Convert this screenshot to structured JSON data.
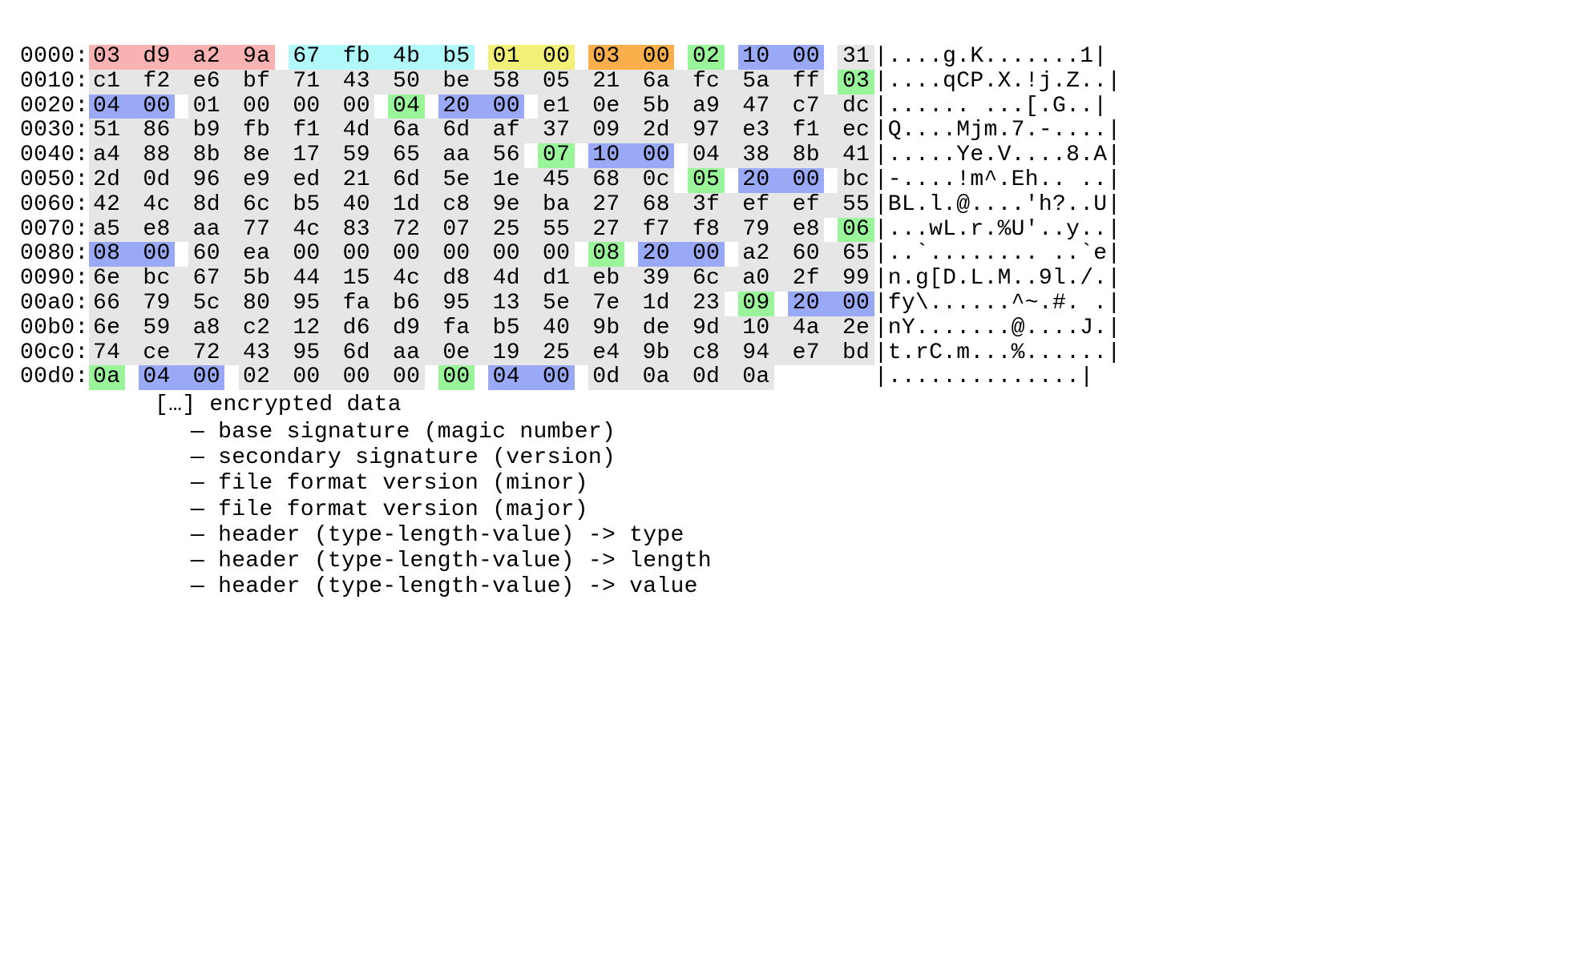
{
  "colors": {
    "pink": "#fab1b1",
    "cyan": "#b1f8fa",
    "yellow": "#f2f077",
    "orange": "#faaf4a",
    "green": "#9af59a",
    "blue": "#9aa9f5",
    "grey": "#e6e6e6"
  },
  "note": "[…] encrypted data",
  "legend": [
    {
      "color": "pink",
      "label": "— base signature (magic number)"
    },
    {
      "color": "cyan",
      "label": "— secondary signature (version)"
    },
    {
      "color": "yellow",
      "label": "— file format version (minor)"
    },
    {
      "color": "orange",
      "label": "— file format version (major)"
    },
    {
      "color": "green",
      "label": "— header (type-length-value) -> type"
    },
    {
      "color": "blue",
      "label": "— header (type-length-value) -> length"
    },
    {
      "color": "grey",
      "label": "— header (type-length-value) -> value"
    }
  ],
  "rows": [
    {
      "offset": "0000:",
      "bytes": [
        {
          "v": "03",
          "c": "pink"
        },
        {
          "v": "d9",
          "c": "pink"
        },
        {
          "v": "a2",
          "c": "pink"
        },
        {
          "v": "9a",
          "c": "pink"
        },
        {
          "v": "67",
          "c": "cyan"
        },
        {
          "v": "fb",
          "c": "cyan"
        },
        {
          "v": "4b",
          "c": "cyan"
        },
        {
          "v": "b5",
          "c": "cyan"
        },
        {
          "v": "01",
          "c": "yellow"
        },
        {
          "v": "00",
          "c": "yellow"
        },
        {
          "v": "03",
          "c": "orange"
        },
        {
          "v": "00",
          "c": "orange"
        },
        {
          "v": "02",
          "c": "green"
        },
        {
          "v": "10",
          "c": "blue"
        },
        {
          "v": "00",
          "c": "blue"
        },
        {
          "v": "31",
          "c": "grey"
        }
      ],
      "ascii": "|....g.K.......1|"
    },
    {
      "offset": "0010:",
      "bytes": [
        {
          "v": "c1",
          "c": "grey"
        },
        {
          "v": "f2",
          "c": "grey"
        },
        {
          "v": "e6",
          "c": "grey"
        },
        {
          "v": "bf",
          "c": "grey"
        },
        {
          "v": "71",
          "c": "grey"
        },
        {
          "v": "43",
          "c": "grey"
        },
        {
          "v": "50",
          "c": "grey"
        },
        {
          "v": "be",
          "c": "grey"
        },
        {
          "v": "58",
          "c": "grey"
        },
        {
          "v": "05",
          "c": "grey"
        },
        {
          "v": "21",
          "c": "grey"
        },
        {
          "v": "6a",
          "c": "grey"
        },
        {
          "v": "fc",
          "c": "grey"
        },
        {
          "v": "5a",
          "c": "grey"
        },
        {
          "v": "ff",
          "c": "grey"
        },
        {
          "v": "03",
          "c": "green"
        }
      ],
      "ascii": "|....qCP.X.!j.Z..|"
    },
    {
      "offset": "0020:",
      "bytes": [
        {
          "v": "04",
          "c": "blue"
        },
        {
          "v": "00",
          "c": "blue"
        },
        {
          "v": "01",
          "c": "grey"
        },
        {
          "v": "00",
          "c": "grey"
        },
        {
          "v": "00",
          "c": "grey"
        },
        {
          "v": "00",
          "c": "grey"
        },
        {
          "v": "04",
          "c": "green"
        },
        {
          "v": "20",
          "c": "blue"
        },
        {
          "v": "00",
          "c": "blue"
        },
        {
          "v": "e1",
          "c": "grey"
        },
        {
          "v": "0e",
          "c": "grey"
        },
        {
          "v": "5b",
          "c": "grey"
        },
        {
          "v": "a9",
          "c": "grey"
        },
        {
          "v": "47",
          "c": "grey"
        },
        {
          "v": "c7",
          "c": "grey"
        },
        {
          "v": "dc",
          "c": "grey"
        }
      ],
      "ascii": "|...... ...[.G..|"
    },
    {
      "offset": "0030:",
      "bytes": [
        {
          "v": "51",
          "c": "grey"
        },
        {
          "v": "86",
          "c": "grey"
        },
        {
          "v": "b9",
          "c": "grey"
        },
        {
          "v": "fb",
          "c": "grey"
        },
        {
          "v": "f1",
          "c": "grey"
        },
        {
          "v": "4d",
          "c": "grey"
        },
        {
          "v": "6a",
          "c": "grey"
        },
        {
          "v": "6d",
          "c": "grey"
        },
        {
          "v": "af",
          "c": "grey"
        },
        {
          "v": "37",
          "c": "grey"
        },
        {
          "v": "09",
          "c": "grey"
        },
        {
          "v": "2d",
          "c": "grey"
        },
        {
          "v": "97",
          "c": "grey"
        },
        {
          "v": "e3",
          "c": "grey"
        },
        {
          "v": "f1",
          "c": "grey"
        },
        {
          "v": "ec",
          "c": "grey"
        }
      ],
      "ascii": "|Q....Mjm.7.-....|"
    },
    {
      "offset": "0040:",
      "bytes": [
        {
          "v": "a4",
          "c": "grey"
        },
        {
          "v": "88",
          "c": "grey"
        },
        {
          "v": "8b",
          "c": "grey"
        },
        {
          "v": "8e",
          "c": "grey"
        },
        {
          "v": "17",
          "c": "grey"
        },
        {
          "v": "59",
          "c": "grey"
        },
        {
          "v": "65",
          "c": "grey"
        },
        {
          "v": "aa",
          "c": "grey"
        },
        {
          "v": "56",
          "c": "grey"
        },
        {
          "v": "07",
          "c": "green"
        },
        {
          "v": "10",
          "c": "blue"
        },
        {
          "v": "00",
          "c": "blue"
        },
        {
          "v": "04",
          "c": "grey"
        },
        {
          "v": "38",
          "c": "grey"
        },
        {
          "v": "8b",
          "c": "grey"
        },
        {
          "v": "41",
          "c": "grey"
        }
      ],
      "ascii": "|.....Ye.V....8.A|"
    },
    {
      "offset": "0050:",
      "bytes": [
        {
          "v": "2d",
          "c": "grey"
        },
        {
          "v": "0d",
          "c": "grey"
        },
        {
          "v": "96",
          "c": "grey"
        },
        {
          "v": "e9",
          "c": "grey"
        },
        {
          "v": "ed",
          "c": "grey"
        },
        {
          "v": "21",
          "c": "grey"
        },
        {
          "v": "6d",
          "c": "grey"
        },
        {
          "v": "5e",
          "c": "grey"
        },
        {
          "v": "1e",
          "c": "grey"
        },
        {
          "v": "45",
          "c": "grey"
        },
        {
          "v": "68",
          "c": "grey"
        },
        {
          "v": "0c",
          "c": "grey"
        },
        {
          "v": "05",
          "c": "green"
        },
        {
          "v": "20",
          "c": "blue"
        },
        {
          "v": "00",
          "c": "blue"
        },
        {
          "v": "bc",
          "c": "grey"
        }
      ],
      "ascii": "|-....!m^.Eh.. ..|"
    },
    {
      "offset": "0060:",
      "bytes": [
        {
          "v": "42",
          "c": "grey"
        },
        {
          "v": "4c",
          "c": "grey"
        },
        {
          "v": "8d",
          "c": "grey"
        },
        {
          "v": "6c",
          "c": "grey"
        },
        {
          "v": "b5",
          "c": "grey"
        },
        {
          "v": "40",
          "c": "grey"
        },
        {
          "v": "1d",
          "c": "grey"
        },
        {
          "v": "c8",
          "c": "grey"
        },
        {
          "v": "9e",
          "c": "grey"
        },
        {
          "v": "ba",
          "c": "grey"
        },
        {
          "v": "27",
          "c": "grey"
        },
        {
          "v": "68",
          "c": "grey"
        },
        {
          "v": "3f",
          "c": "grey"
        },
        {
          "v": "ef",
          "c": "grey"
        },
        {
          "v": "ef",
          "c": "grey"
        },
        {
          "v": "55",
          "c": "grey"
        }
      ],
      "ascii": "|BL.l.@....'h?..U|"
    },
    {
      "offset": "0070:",
      "bytes": [
        {
          "v": "a5",
          "c": "grey"
        },
        {
          "v": "e8",
          "c": "grey"
        },
        {
          "v": "aa",
          "c": "grey"
        },
        {
          "v": "77",
          "c": "grey"
        },
        {
          "v": "4c",
          "c": "grey"
        },
        {
          "v": "83",
          "c": "grey"
        },
        {
          "v": "72",
          "c": "grey"
        },
        {
          "v": "07",
          "c": "grey"
        },
        {
          "v": "25",
          "c": "grey"
        },
        {
          "v": "55",
          "c": "grey"
        },
        {
          "v": "27",
          "c": "grey"
        },
        {
          "v": "f7",
          "c": "grey"
        },
        {
          "v": "f8",
          "c": "grey"
        },
        {
          "v": "79",
          "c": "grey"
        },
        {
          "v": "e8",
          "c": "grey"
        },
        {
          "v": "06",
          "c": "green"
        }
      ],
      "ascii": "|...wL.r.%U'..y..|"
    },
    {
      "offset": "0080:",
      "bytes": [
        {
          "v": "08",
          "c": "blue"
        },
        {
          "v": "00",
          "c": "blue"
        },
        {
          "v": "60",
          "c": "grey"
        },
        {
          "v": "ea",
          "c": "grey"
        },
        {
          "v": "00",
          "c": "grey"
        },
        {
          "v": "00",
          "c": "grey"
        },
        {
          "v": "00",
          "c": "grey"
        },
        {
          "v": "00",
          "c": "grey"
        },
        {
          "v": "00",
          "c": "grey"
        },
        {
          "v": "00",
          "c": "grey"
        },
        {
          "v": "08",
          "c": "green"
        },
        {
          "v": "20",
          "c": "blue"
        },
        {
          "v": "00",
          "c": "blue"
        },
        {
          "v": "a2",
          "c": "grey"
        },
        {
          "v": "60",
          "c": "grey"
        },
        {
          "v": "65",
          "c": "grey"
        }
      ],
      "ascii": "|..`........ ..`e|"
    },
    {
      "offset": "0090:",
      "bytes": [
        {
          "v": "6e",
          "c": "grey"
        },
        {
          "v": "bc",
          "c": "grey"
        },
        {
          "v": "67",
          "c": "grey"
        },
        {
          "v": "5b",
          "c": "grey"
        },
        {
          "v": "44",
          "c": "grey"
        },
        {
          "v": "15",
          "c": "grey"
        },
        {
          "v": "4c",
          "c": "grey"
        },
        {
          "v": "d8",
          "c": "grey"
        },
        {
          "v": "4d",
          "c": "grey"
        },
        {
          "v": "d1",
          "c": "grey"
        },
        {
          "v": "eb",
          "c": "grey"
        },
        {
          "v": "39",
          "c": "grey"
        },
        {
          "v": "6c",
          "c": "grey"
        },
        {
          "v": "a0",
          "c": "grey"
        },
        {
          "v": "2f",
          "c": "grey"
        },
        {
          "v": "99",
          "c": "grey"
        }
      ],
      "ascii": "|n.g[D.L.M..9l./.|"
    },
    {
      "offset": "00a0:",
      "bytes": [
        {
          "v": "66",
          "c": "grey"
        },
        {
          "v": "79",
          "c": "grey"
        },
        {
          "v": "5c",
          "c": "grey"
        },
        {
          "v": "80",
          "c": "grey"
        },
        {
          "v": "95",
          "c": "grey"
        },
        {
          "v": "fa",
          "c": "grey"
        },
        {
          "v": "b6",
          "c": "grey"
        },
        {
          "v": "95",
          "c": "grey"
        },
        {
          "v": "13",
          "c": "grey"
        },
        {
          "v": "5e",
          "c": "grey"
        },
        {
          "v": "7e",
          "c": "grey"
        },
        {
          "v": "1d",
          "c": "grey"
        },
        {
          "v": "23",
          "c": "grey"
        },
        {
          "v": "09",
          "c": "green"
        },
        {
          "v": "20",
          "c": "blue"
        },
        {
          "v": "00",
          "c": "blue"
        }
      ],
      "ascii": "|fy\\......^~.#. .|"
    },
    {
      "offset": "00b0:",
      "bytes": [
        {
          "v": "6e",
          "c": "grey"
        },
        {
          "v": "59",
          "c": "grey"
        },
        {
          "v": "a8",
          "c": "grey"
        },
        {
          "v": "c2",
          "c": "grey"
        },
        {
          "v": "12",
          "c": "grey"
        },
        {
          "v": "d6",
          "c": "grey"
        },
        {
          "v": "d9",
          "c": "grey"
        },
        {
          "v": "fa",
          "c": "grey"
        },
        {
          "v": "b5",
          "c": "grey"
        },
        {
          "v": "40",
          "c": "grey"
        },
        {
          "v": "9b",
          "c": "grey"
        },
        {
          "v": "de",
          "c": "grey"
        },
        {
          "v": "9d",
          "c": "grey"
        },
        {
          "v": "10",
          "c": "grey"
        },
        {
          "v": "4a",
          "c": "grey"
        },
        {
          "v": "2e",
          "c": "grey"
        }
      ],
      "ascii": "|nY.......@....J.|"
    },
    {
      "offset": "00c0:",
      "bytes": [
        {
          "v": "74",
          "c": "grey"
        },
        {
          "v": "ce",
          "c": "grey"
        },
        {
          "v": "72",
          "c": "grey"
        },
        {
          "v": "43",
          "c": "grey"
        },
        {
          "v": "95",
          "c": "grey"
        },
        {
          "v": "6d",
          "c": "grey"
        },
        {
          "v": "aa",
          "c": "grey"
        },
        {
          "v": "0e",
          "c": "grey"
        },
        {
          "v": "19",
          "c": "grey"
        },
        {
          "v": "25",
          "c": "grey"
        },
        {
          "v": "e4",
          "c": "grey"
        },
        {
          "v": "9b",
          "c": "grey"
        },
        {
          "v": "c8",
          "c": "grey"
        },
        {
          "v": "94",
          "c": "grey"
        },
        {
          "v": "e7",
          "c": "grey"
        },
        {
          "v": "bd",
          "c": "grey"
        }
      ],
      "ascii": "|t.rC.m...%......|"
    },
    {
      "offset": "00d0:",
      "bytes": [
        {
          "v": "0a",
          "c": "green"
        },
        {
          "v": "04",
          "c": "blue"
        },
        {
          "v": "00",
          "c": "blue"
        },
        {
          "v": "02",
          "c": "grey"
        },
        {
          "v": "00",
          "c": "grey"
        },
        {
          "v": "00",
          "c": "grey"
        },
        {
          "v": "00",
          "c": "grey"
        },
        {
          "v": "00",
          "c": "green"
        },
        {
          "v": "04",
          "c": "blue"
        },
        {
          "v": "00",
          "c": "blue"
        },
        {
          "v": "0d",
          "c": "grey"
        },
        {
          "v": "0a",
          "c": "grey"
        },
        {
          "v": "0d",
          "c": "grey"
        },
        {
          "v": "0a",
          "c": "grey"
        }
      ],
      "ascii": "|..............|"
    }
  ]
}
